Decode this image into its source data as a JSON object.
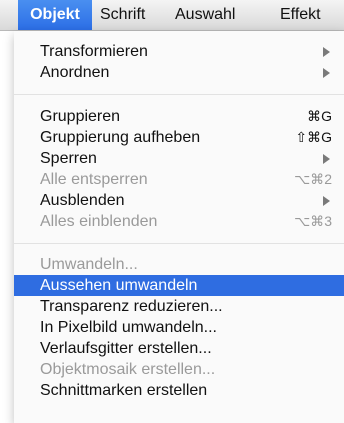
{
  "menubar": {
    "items": [
      {
        "label": "Objekt"
      },
      {
        "label": "Schrift"
      },
      {
        "label": "Auswahl"
      },
      {
        "label": "Effekt"
      }
    ]
  },
  "menu": {
    "items": [
      {
        "label": "Transformieren",
        "submenu": true
      },
      {
        "label": "Anordnen",
        "submenu": true
      },
      {
        "label": "Gruppieren",
        "shortcut": "⌘G"
      },
      {
        "label": "Gruppierung aufheben",
        "shortcut": "⇧⌘G"
      },
      {
        "label": "Sperren",
        "submenu": true
      },
      {
        "label": "Alle entsperren",
        "shortcut": "⌥⌘2",
        "disabled": true
      },
      {
        "label": "Ausblenden",
        "submenu": true
      },
      {
        "label": "Alles einblenden",
        "shortcut": "⌥⌘3",
        "disabled": true
      },
      {
        "label": "Umwandeln...",
        "disabled": true
      },
      {
        "label": "Aussehen umwandeln",
        "highlighted": true
      },
      {
        "label": "Transparenz reduzieren..."
      },
      {
        "label": "In Pixelbild umwandeln..."
      },
      {
        "label": "Verlaufsgitter erstellen..."
      },
      {
        "label": "Objektmosaik erstellen...",
        "disabled": true
      },
      {
        "label": "Schnittmarken erstellen"
      }
    ]
  },
  "colors": {
    "highlight": "#2f6de1",
    "disabled_text": "#9a9a9a"
  }
}
